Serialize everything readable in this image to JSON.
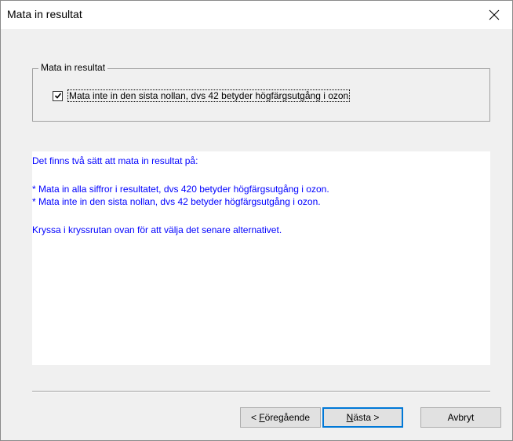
{
  "window": {
    "title": "Mata in resultat"
  },
  "group": {
    "legend": "Mata in resultat",
    "checkbox_label": "Mata inte in den sista nollan, dvs 42 betyder högfärgsutgång i ozon",
    "checkbox_checked": true
  },
  "info": {
    "line1": "Det finns två sätt att mata in resultat på:",
    "line2": "* Mata in alla siffror i resultatet, dvs 420 betyder högfärgsutgång i ozon.",
    "line3": "* Mata inte in den sista nollan, dvs 42 betyder högfärgsutgång i ozon.",
    "line4": "Kryssa i kryssrutan ovan för att välja det senare alternativet.",
    "text_color": "#0000ff"
  },
  "buttons": {
    "prev_prefix": "< ",
    "prev_mnemonic": "F",
    "prev_rest": "öregående",
    "next_mnemonic": "N",
    "next_rest": "ästa >",
    "cancel": "Avbryt"
  },
  "icons": {
    "close": "close-icon",
    "check": "checkmark-icon"
  }
}
